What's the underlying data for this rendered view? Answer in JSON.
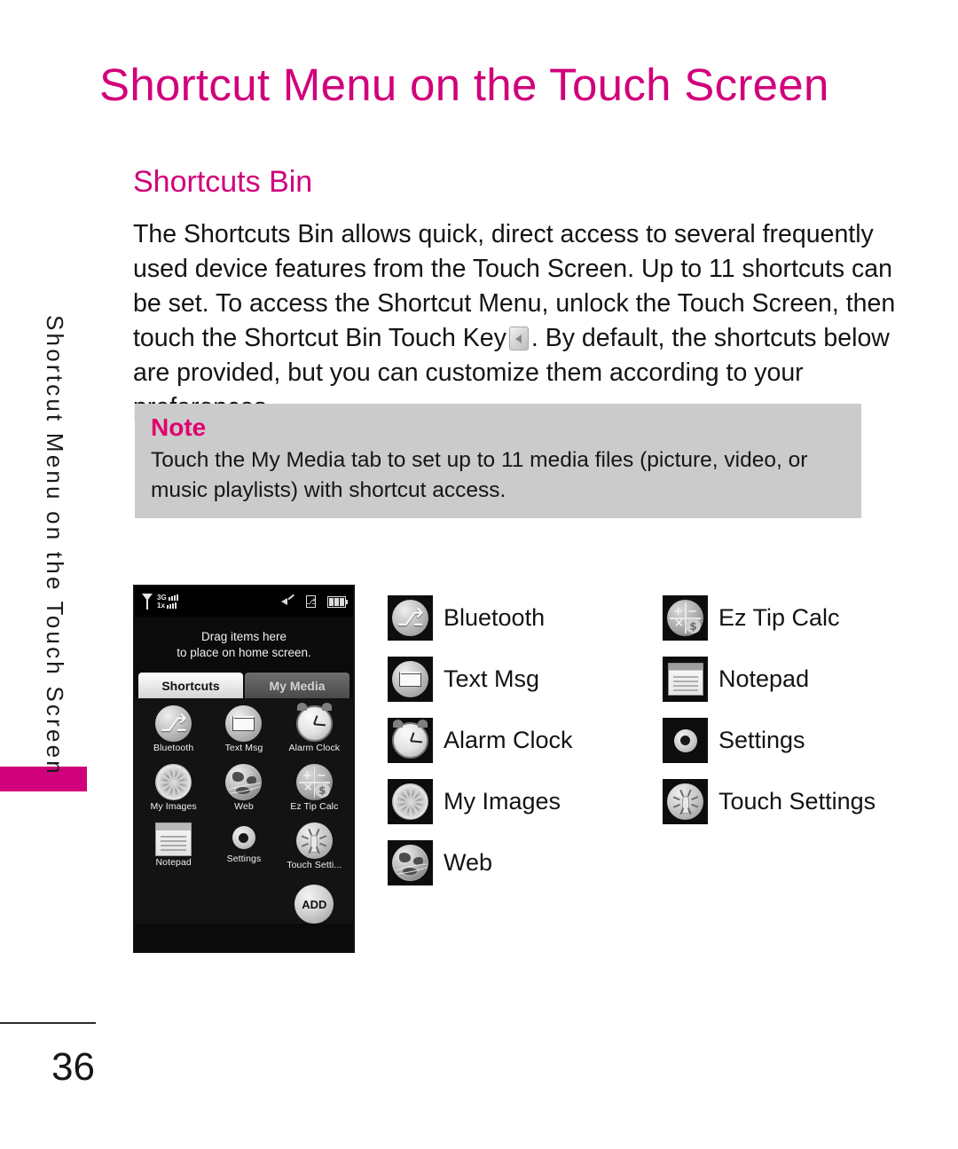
{
  "document": {
    "page_title": "Shortcut Menu on the Touch Screen",
    "section_heading": "Shortcuts Bin",
    "page_number": "36",
    "accent_color": "#D1007B",
    "note_bg_color": "#CBCBCB"
  },
  "sidebar": {
    "vertical_label": "Shortcut Menu on the Touch Screen"
  },
  "body": {
    "paragraph_part1": "The Shortcuts Bin allows quick, direct access to several frequently used device features from the Touch Screen. Up to 11 shortcuts can be set. To access the Shortcut Menu, unlock the Touch Screen, then touch the Shortcut Bin Touch Key",
    "paragraph_part2": ". By default, the shortcuts below are provided, but you can customize them according to your preferences.",
    "touch_key_icon": "shortcut-bin-touch-key-icon"
  },
  "note": {
    "title": "Note",
    "text": "Touch the My Media tab to set up to 11 media files (picture, video, or music playlists) with shortcut access."
  },
  "phone": {
    "status_bar": {
      "antenna_icon": "antenna-icon",
      "network_3g_label": "3G",
      "network_1x_label": "1x",
      "mute_icon": "sound-off-icon",
      "bluetooth_icon": "bluetooth-status-icon",
      "battery_icon": "battery-icon"
    },
    "drag_hint_line1": "Drag items here",
    "drag_hint_line2": "to place on home screen.",
    "tabs": [
      {
        "label": "Shortcuts",
        "active": true
      },
      {
        "label": "My Media",
        "active": false
      }
    ],
    "grid": [
      {
        "label": "Bluetooth",
        "icon": "bluetooth-icon"
      },
      {
        "label": "Text Msg",
        "icon": "envelope-icon"
      },
      {
        "label": "Alarm Clock",
        "icon": "alarm-clock-icon"
      },
      {
        "label": "My Images",
        "icon": "my-images-icon"
      },
      {
        "label": "Web",
        "icon": "globe-icon"
      },
      {
        "label": "Ez Tip Calc",
        "icon": "calculator-icon"
      },
      {
        "label": "Notepad",
        "icon": "notepad-icon"
      },
      {
        "label": "Settings",
        "icon": "gear-icon"
      },
      {
        "label": "Touch Setti...",
        "icon": "touch-settings-icon"
      }
    ],
    "add_button_label": "ADD"
  },
  "legend": {
    "column1": [
      {
        "label": "Bluetooth",
        "icon": "bluetooth-icon"
      },
      {
        "label": "Text Msg",
        "icon": "envelope-icon"
      },
      {
        "label": "Alarm Clock",
        "icon": "alarm-clock-icon"
      },
      {
        "label": "My Images",
        "icon": "my-images-icon"
      },
      {
        "label": "Web",
        "icon": "globe-icon"
      }
    ],
    "column2": [
      {
        "label": "Ez Tip Calc",
        "icon": "calculator-icon"
      },
      {
        "label": "Notepad",
        "icon": "notepad-icon"
      },
      {
        "label": "Settings",
        "icon": "gear-icon"
      },
      {
        "label": "Touch Settings",
        "icon": "touch-settings-icon"
      }
    ]
  }
}
